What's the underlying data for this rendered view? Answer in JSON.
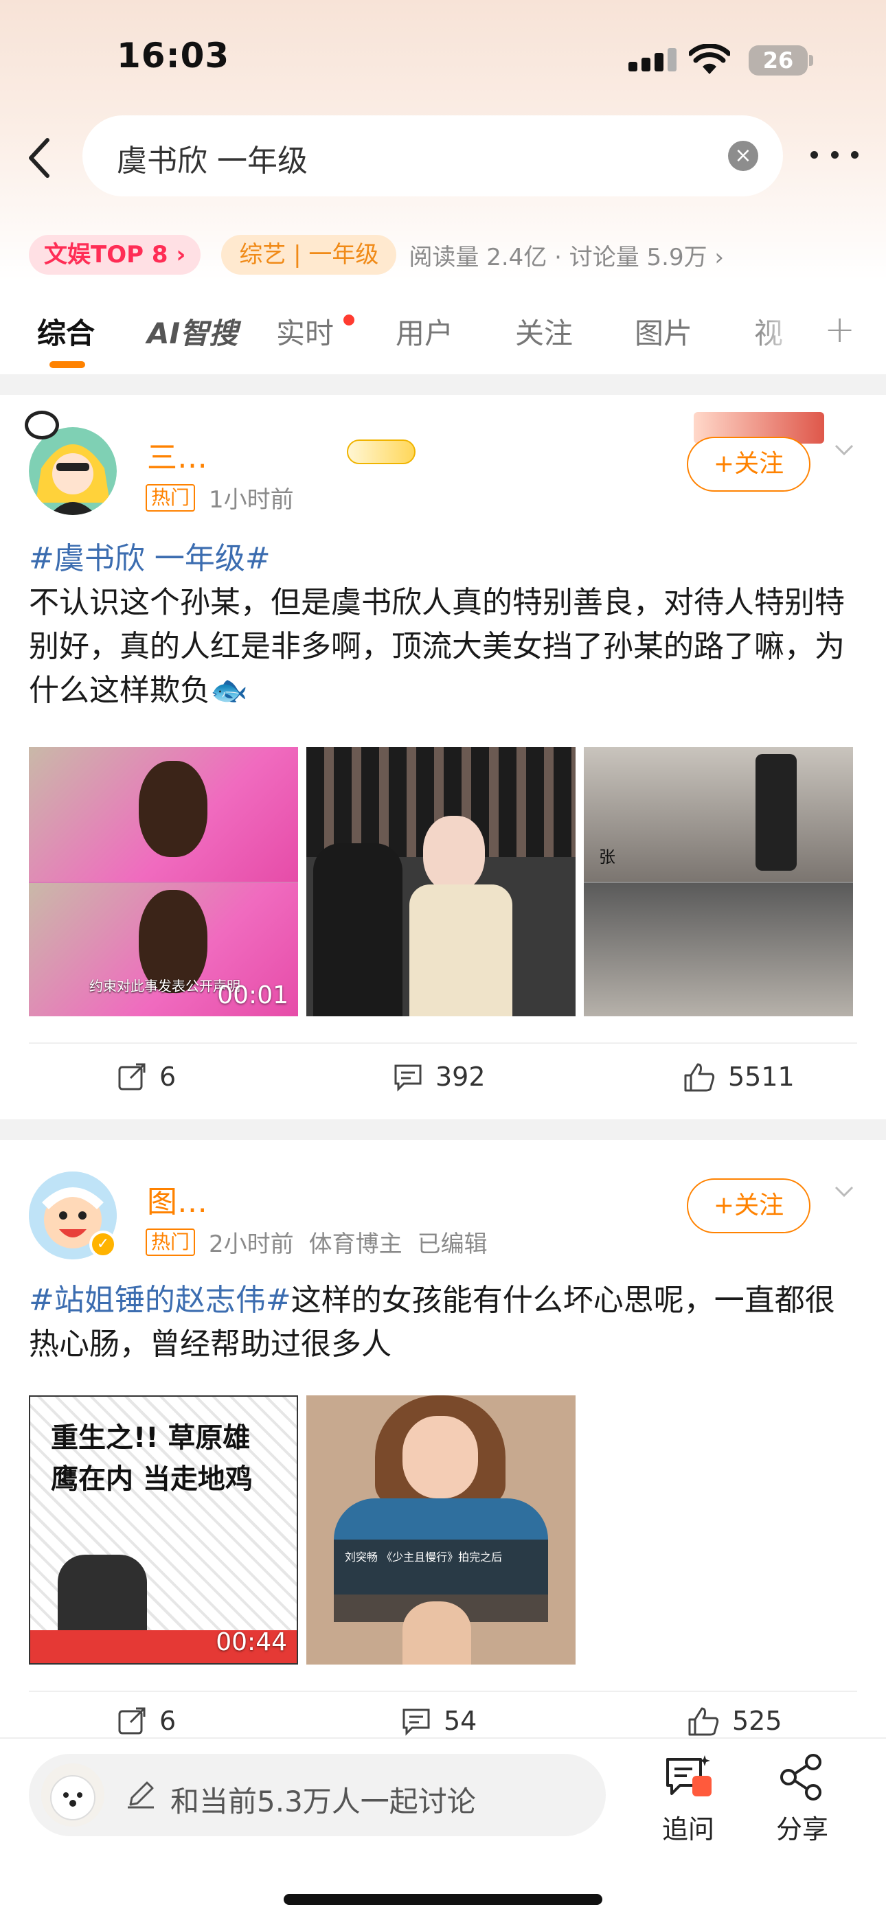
{
  "status_bar": {
    "time": "16:03",
    "battery": "26"
  },
  "search": {
    "query": "虞书欣 一年级"
  },
  "trend": {
    "rank_badge": "文娱TOP 8 ›",
    "category": "综艺 | 一年级",
    "stats": "阅读量 2.4亿 · 讨论量 5.9万 ›"
  },
  "tabs": [
    {
      "label": "综合",
      "active": true
    },
    {
      "label": "AI智搜"
    },
    {
      "label": "实时",
      "has_dot": true
    },
    {
      "label": "用户"
    },
    {
      "label": "关注"
    },
    {
      "label": "图片"
    },
    {
      "label": "视"
    }
  ],
  "posts": [
    {
      "username": "三…",
      "hot_tag": "热门",
      "time": "1小时前",
      "follow_label": "+关注",
      "topic": "#虞书欣 一年级#",
      "text": "不认识这个孙某，但是虞书欣人真的特别善良，对待人特别特别好，真的人红是非多啊，顶流大美女挡了孙某的路了嘛，为什么这样欺负",
      "images": [
        {
          "caption": "约束对此事发表公开声明",
          "duration": "00:01"
        },
        {
          "caption": ""
        },
        {
          "caption": "张"
        }
      ],
      "reposts": "6",
      "comments": "392",
      "likes": "5511"
    },
    {
      "username": "图…",
      "hot_tag": "热门",
      "time": "2小时前",
      "role": "体育博主",
      "edited": "已编辑",
      "follow_label": "+关注",
      "topic": "#站姐锤的赵志伟#",
      "text": "这样的女孩能有什么坏心思呢，一直都很热心肠，曾经帮助过很多人",
      "images": [
        {
          "caption": "重生之!! 草原雄鹰在内 当走地鸡",
          "duration": "00:44"
        },
        {
          "caption": "刘突畅 《少主且慢行》拍完之后"
        }
      ],
      "reposts": "6",
      "comments": "54",
      "likes": "525"
    }
  ],
  "bottom": {
    "placeholder": "和当前5.3万人一起讨论",
    "ask_label": "追问",
    "share_label": "分享"
  },
  "colors": {
    "accent": "#ff8200",
    "topic": "#3c6db0",
    "hot_red": "#ff2d55"
  }
}
